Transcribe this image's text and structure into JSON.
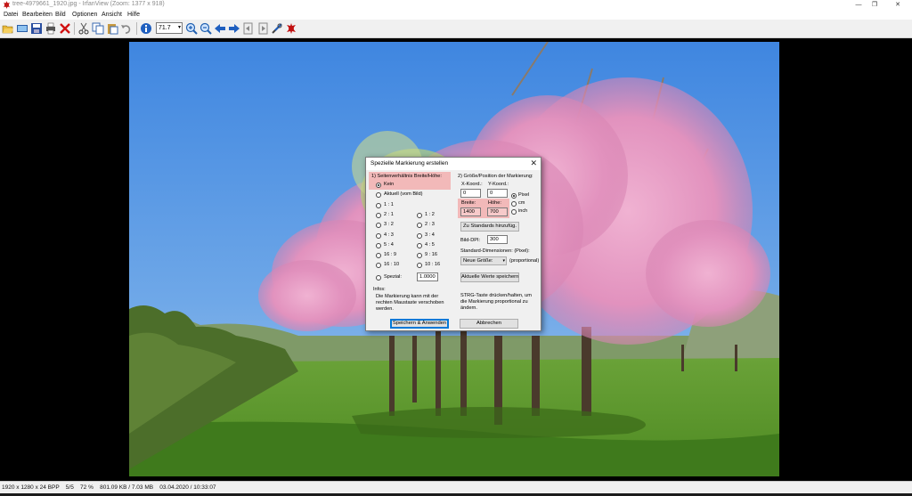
{
  "window": {
    "title": "tree-4979661_1920.jpg - IrfanView (Zoom: 1377 x 918)",
    "minimize": "—",
    "maximize": "❐",
    "close": "✕"
  },
  "menu": [
    "Datei",
    "Bearbeiten",
    "Bild",
    "Optionen",
    "Ansicht",
    "Hilfe"
  ],
  "toolbar": {
    "zoom_value": "71.7",
    "icons": [
      "open-icon",
      "slideshow-icon",
      "save-icon",
      "print-icon",
      "delete-icon",
      "cut-icon",
      "copy-icon",
      "paste-icon",
      "undo-icon",
      "info-icon",
      "zoom-in-icon",
      "zoom-out-icon",
      "previous-icon",
      "next-icon",
      "first-page-icon",
      "last-page-icon",
      "settings-icon",
      "exit-icon"
    ]
  },
  "status": {
    "text": "1920 x 1280 x 24 BPP    5/5    72 %    801.09 KB / 7.03 MB    03.04.2020 / 10:33:07"
  },
  "dialog": {
    "title": "Spezielle Markierung erstellen",
    "close": "✕",
    "left": {
      "heading": "1) Seitenverhältnis Breite/Höhe:",
      "none_label": "Kein",
      "current_label": "Aktuell (vom Bild)",
      "ratios_left": [
        "1 : 1",
        "2 : 1",
        "3 : 2",
        "4 : 3",
        "5 : 4",
        "16 : 9",
        "16 : 10"
      ],
      "ratios_right": [
        "1 : 2",
        "2 : 3",
        "3 : 4",
        "4 : 5",
        "9 : 16",
        "10 : 16"
      ],
      "mirror_label": "Spezial:",
      "mirror_value": "1.0000",
      "info_heading": "Infos:",
      "info_text_1": "Die Markierung kann mit der",
      "info_text_2": "rechten Maustaste verschoben",
      "info_text_3": "werden."
    },
    "right": {
      "heading": "2) Größe/Position der Markierung:",
      "x_label": "X-Koord.:",
      "y_label": "Y-Koord.:",
      "x_value": "0",
      "y_value": "0",
      "unit_pixel": "Pixel",
      "unit_cm": "cm",
      "unit_inch": "inch",
      "width_label": "Breite:",
      "height_label": "Höhe:",
      "width_value": "1400",
      "height_value": "700",
      "add_standard_button": "Zu Standards hinzufüg.",
      "dpi_label": "Bild-DPI:",
      "dpi_value": "300",
      "std_dims_label": "Standard-Dimensionen: (Pixel):",
      "std_dims_value": "Neue Größe:",
      "proportional_label": "(proportional)",
      "save_current_button": "Aktuelle Werte speichern",
      "hint_1": "STRG-Taste drücken/halten, um",
      "hint_2": "die Markierung proportional zu",
      "hint_3": "ändern."
    },
    "buttons": {
      "apply": "Speichern & Anwenden",
      "cancel": "Abbrechen"
    }
  },
  "colors": {
    "highlight": "#f2b9b9",
    "sky": "#5b97df",
    "grass": "#5a9a2a",
    "blossom": "#e7a2c6"
  }
}
